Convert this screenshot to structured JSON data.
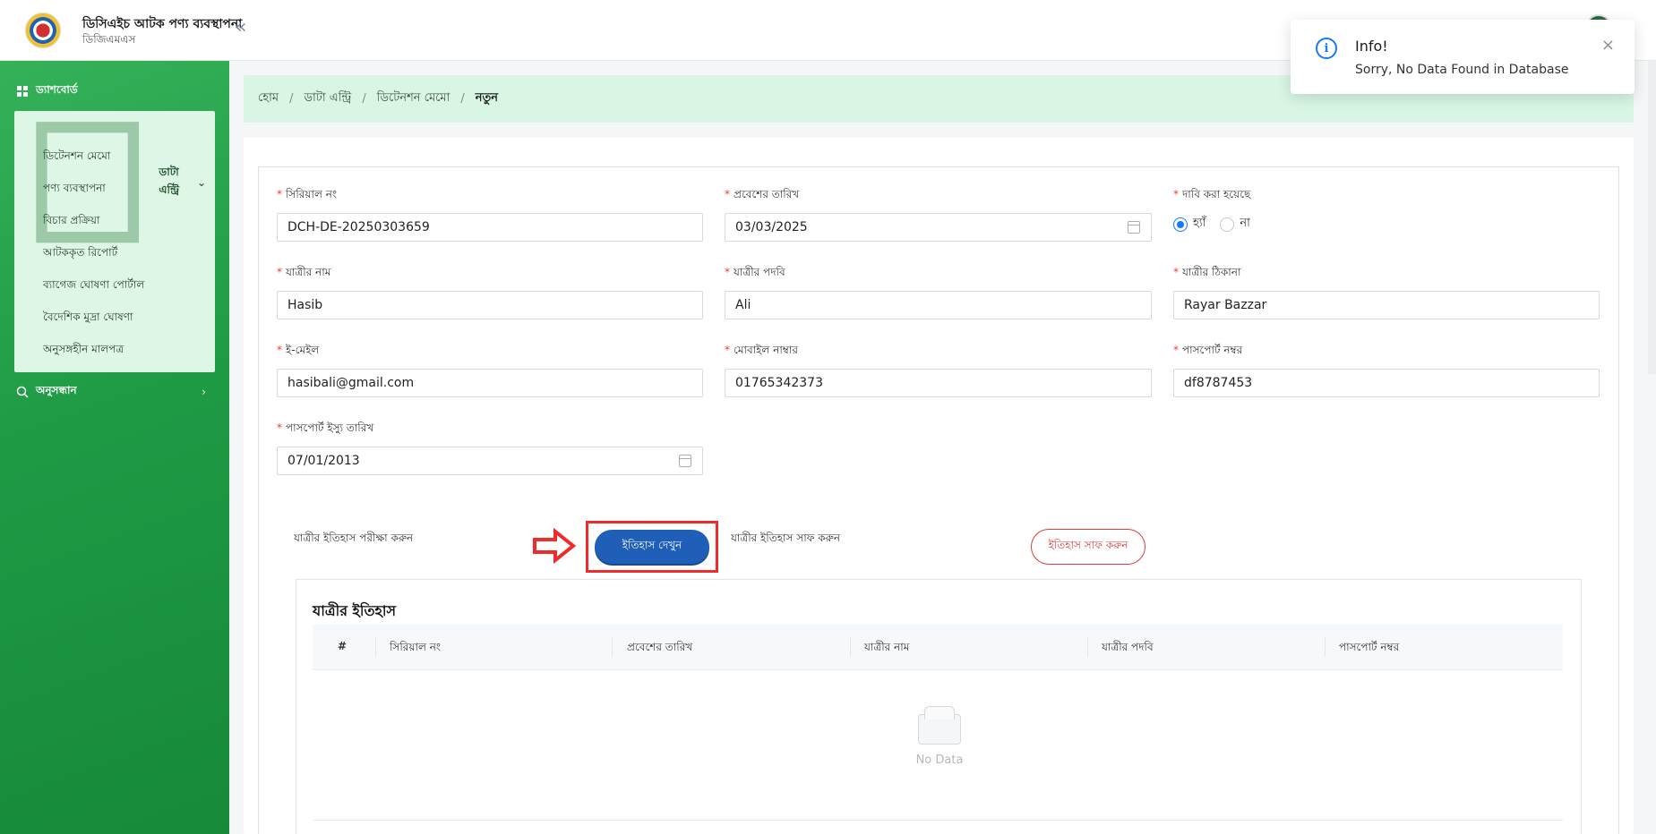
{
  "header": {
    "app_title": "ডিসিএইচ আটক পণ্য ব্যবস্থাপনা",
    "app_subtitle": "ডিজিএমএস",
    "collapse_icon": "«"
  },
  "sidebar": {
    "dashboard": "ড্যাশবোর্ড",
    "data_entry": "ডাটা এন্ট্রি",
    "sub_items": [
      "ডিটেনশন মেমো",
      "পণ্য ব্যবস্থাপনা",
      "বিচার প্রক্রিয়া",
      "আটককৃত রিপোর্ট",
      "ব্যাগেজ ঘোষণা পোর্টাল",
      "বৈদেশিক মুদ্রা ঘোষণা",
      "অনুসঙ্গহীন মালপত্র"
    ],
    "search": "অনুসন্ধান"
  },
  "breadcrumb": {
    "items": [
      "হোম",
      "ডাটা এন্ট্রি",
      "ডিটেনশন মেমো"
    ],
    "current": "নতুন",
    "separator": "/"
  },
  "form": {
    "serial_label": "সিরিয়াল নং",
    "serial_value": "DCH-DE-20250303659",
    "entry_date_label": "প্রবেশের তারিখ",
    "entry_date_value": "03/03/2025",
    "claimed_label": "দাবি করা হয়েছে",
    "claimed_yes": "হ্যাঁ",
    "claimed_no": "না",
    "passenger_name_label": "যাত্রীর নাম",
    "passenger_name_value": "Hasib",
    "passenger_title_label": "যাত্রীর পদবি",
    "passenger_title_value": "Ali",
    "passenger_address_label": "যাত্রীর ঠিকানা",
    "passenger_address_value": "Rayar Bazzar",
    "email_label": "ই-মেইল",
    "email_value": "hasibali@gmail.com",
    "mobile_label": "মোবাইল নাম্বার",
    "mobile_value": "01765342373",
    "passport_label": "পাসপোর্ট নম্বর",
    "passport_value": "df8787453",
    "passport_issue_label": "পাসপোর্ট ইস্যু তারিখ",
    "passport_issue_value": "07/01/2013",
    "required_mark": "*"
  },
  "actions": {
    "check_history_text": "যাত্রীর ইতিহাস পরীক্ষা করুন",
    "view_history_button": "ইতিহাস দেখুন",
    "clear_history_text": "যাত্রীর ইতিহাস সাফ করুন",
    "clear_history_button": "ইতিহাস সাফ করুন"
  },
  "history": {
    "title": "যাত্রীর ইতিহাস",
    "columns": [
      "#",
      "সিরিয়াল নং",
      "প্রবেশের তারিখ",
      "যাত্রীর নাম",
      "যাত্রীর পদবি",
      "পাসপোর্ট নম্বর"
    ],
    "empty_text": "No Data"
  },
  "toast": {
    "title": "Info!",
    "message": "Sorry, No Data Found in Database",
    "icon": "i",
    "close": "×"
  },
  "colors": {
    "sidebar_green": "#1f9a45",
    "primary_blue": "#1f5fb8",
    "danger_red": "#e03a3a",
    "highlight_red": "#ef2b2b"
  }
}
